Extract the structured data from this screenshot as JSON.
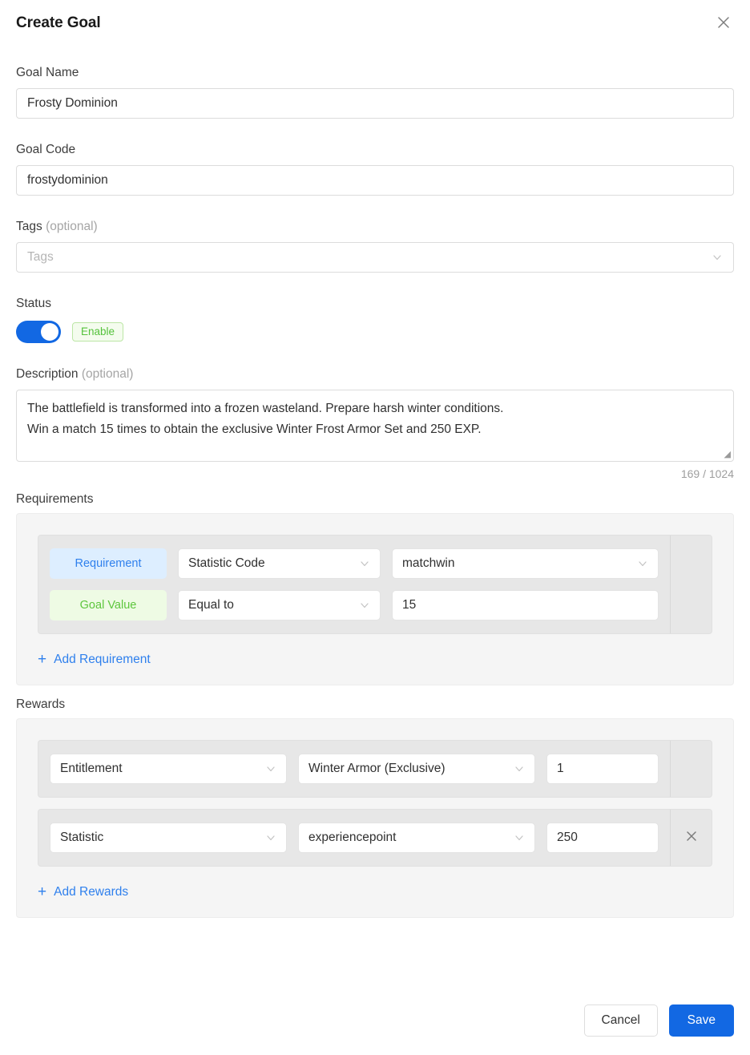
{
  "dialog": {
    "title": "Create Goal",
    "close_icon": "close-icon"
  },
  "fields": {
    "goal_name": {
      "label": "Goal Name",
      "value": "Frosty Dominion",
      "placeholder": "Goal Name"
    },
    "goal_code": {
      "label": "Goal Code",
      "value": "frostydominion",
      "placeholder": "Goal Code"
    },
    "tags": {
      "label": "Tags",
      "optional": "(optional)",
      "value": "",
      "placeholder": "Tags",
      "chevron_icon": "chevron-down-icon"
    },
    "status": {
      "label": "Status",
      "toggle_on": true,
      "badge": "Enable"
    },
    "description": {
      "label": "Description",
      "optional": "(optional)",
      "line1": "The battlefield is transformed into a frozen wasteland. Prepare harsh winter conditions.",
      "line2": "Win a match 15 times to obtain the exclusive Winter Frost Armor Set and 250 EXP.",
      "char_count": "169 / 1024",
      "max_length": 1024
    }
  },
  "requirements": {
    "title": "Requirements",
    "rows": [
      {
        "requirement": {
          "chip": "Requirement",
          "type": "Statistic Code",
          "value": "matchwin"
        },
        "goal_value": {
          "chip": "Goal Value",
          "operator": "Equal to",
          "value": "15"
        },
        "has_delete": false
      }
    ],
    "add_label": "Add Requirement",
    "add_icon": "plus-icon"
  },
  "rewards": {
    "title": "Rewards",
    "rows": [
      {
        "type": "Entitlement",
        "item": "Winter Armor (Exclusive)",
        "quantity": "1",
        "has_delete": false
      },
      {
        "type": "Statistic",
        "item": "experiencepoint",
        "quantity": "250",
        "has_delete": true,
        "delete_icon": "close-icon"
      }
    ],
    "add_label": "Add Rewards",
    "add_icon": "plus-icon"
  },
  "footer": {
    "cancel_label": "Cancel",
    "save_label": "Save"
  },
  "colors": {
    "accent": "#1268e3",
    "link": "#2f80ed",
    "green": "#55c23c",
    "chip_blue_bg": "#ddeeff",
    "chip_green_bg": "#eefbe4",
    "card_bg": "#f5f5f5",
    "row_bg": "#e7e7e7"
  }
}
